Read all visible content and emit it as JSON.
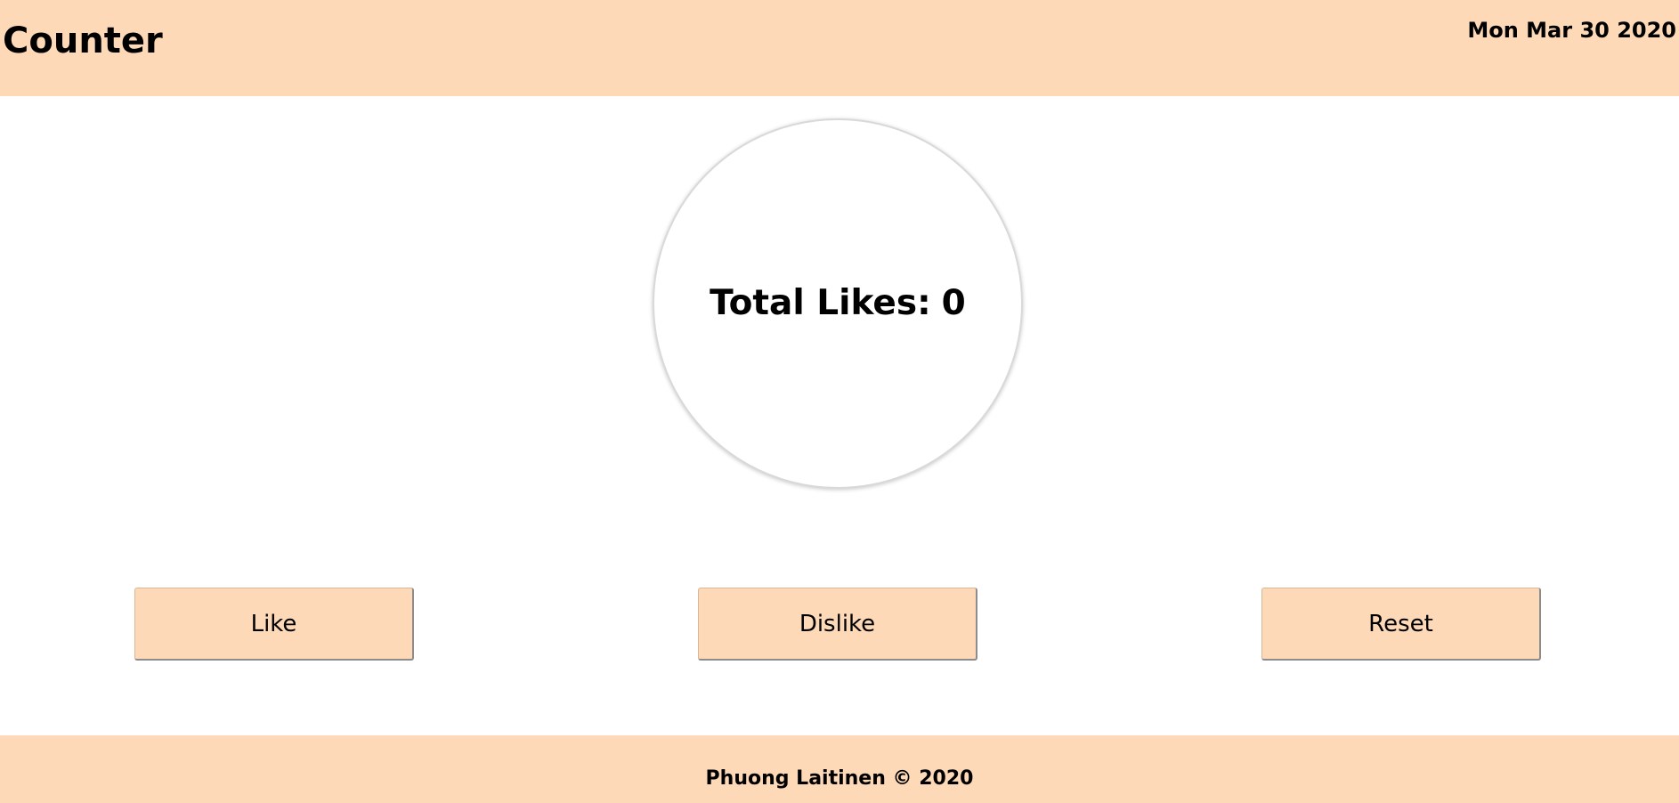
{
  "header": {
    "title": "Counter",
    "date": "Mon Mar 30 2020"
  },
  "counter": {
    "label": "Total Likes:",
    "value": "0"
  },
  "buttons": {
    "like": "Like",
    "dislike": "Dislike",
    "reset": "Reset"
  },
  "footer": {
    "text": "Phuong Laitinen © 2020"
  },
  "colors": {
    "accent": "#fdd9b8",
    "background": "#ffffff",
    "text": "#000000"
  }
}
